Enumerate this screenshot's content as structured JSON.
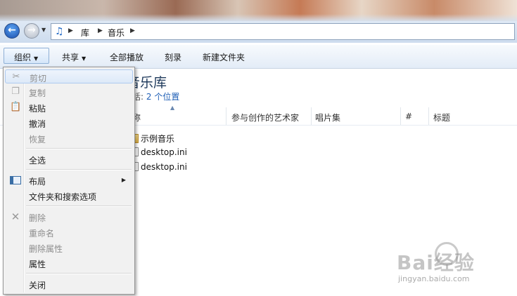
{
  "address_bar": {
    "breadcrumbs": [
      "库",
      "音乐"
    ]
  },
  "toolbar": {
    "organize": "组织",
    "share": "共享",
    "play_all": "全部播放",
    "burn": "刻录",
    "new_folder": "新建文件夹"
  },
  "library": {
    "title": "音乐库",
    "includes_label": "括:",
    "locations_link": "2 个位置"
  },
  "columns": [
    "称",
    "参与创作的艺术家",
    "唱片集",
    "#",
    "标题"
  ],
  "files": [
    {
      "name": "示例音乐",
      "type": "folder"
    },
    {
      "name": "desktop.ini",
      "type": "file"
    },
    {
      "name": "desktop.ini",
      "type": "file"
    }
  ],
  "context_menu": {
    "items": [
      {
        "label": "剪切",
        "enabled": false,
        "icon": "scissors-icon"
      },
      {
        "label": "复制",
        "enabled": false,
        "icon": "copy-icon"
      },
      {
        "label": "粘贴",
        "enabled": true,
        "icon": "clipboard-icon"
      },
      {
        "label": "撤消",
        "enabled": true
      },
      {
        "label": "恢复",
        "enabled": false
      },
      {
        "label": "全选",
        "enabled": true
      },
      {
        "label": "布局",
        "enabled": true,
        "icon": "layout-icon",
        "submenu": true
      },
      {
        "label": "文件夹和搜索选项",
        "enabled": true
      },
      {
        "label": "删除",
        "enabled": false,
        "icon": "delete-x-icon"
      },
      {
        "label": "重命名",
        "enabled": false
      },
      {
        "label": "删除属性",
        "enabled": false
      },
      {
        "label": "属性",
        "enabled": true
      },
      {
        "label": "关闭",
        "enabled": true
      }
    ]
  },
  "watermark": {
    "logo": "Bai经验",
    "url": "jingyan.baidu.com"
  },
  "colors": {
    "accent_link": "#1f5fb6",
    "library_title": "#1e395b",
    "disabled_text": "#8d8d8d"
  }
}
